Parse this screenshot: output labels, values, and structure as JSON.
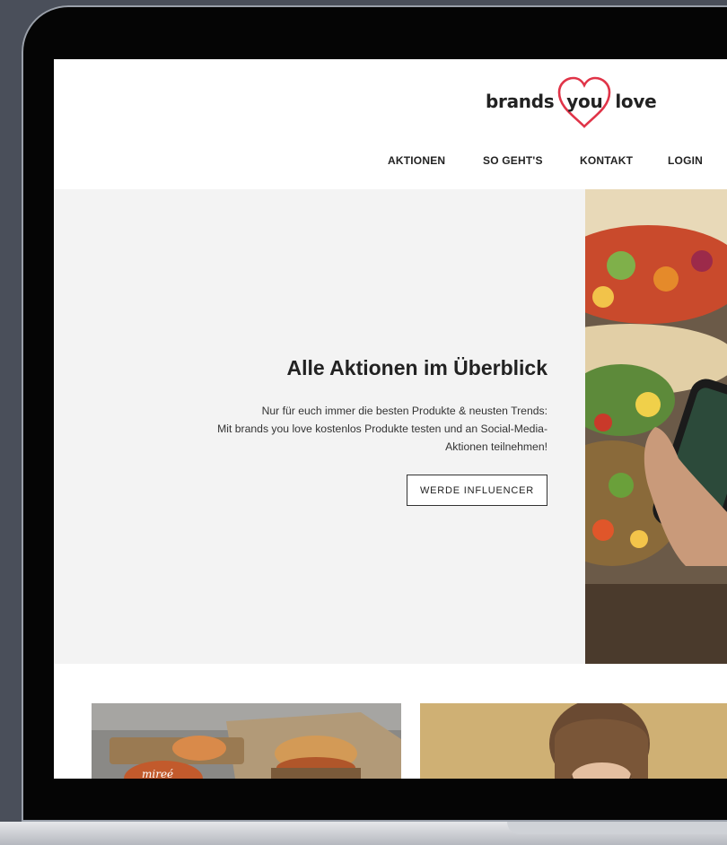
{
  "site": {
    "logo": {
      "part1": "brands",
      "part2": "you",
      "part3": "love",
      "heart_color": "#e03448"
    },
    "nav": [
      {
        "label": "AKTIONEN"
      },
      {
        "label": "SO GEHT'S"
      },
      {
        "label": "KONTAKT"
      },
      {
        "label": "LOGIN"
      }
    ]
  },
  "hero": {
    "title": "Alle Aktionen im Überblick",
    "line1": "Nur für euch immer die besten Produkte & neusten Trends:",
    "line2": "Mit brands you love kostenlos Produkte testen und an Social-Media-",
    "line3": "Aktionen teilnehmen!",
    "cta": "WERDE INFLUENCER",
    "image": "tacos-photo-with-phone"
  },
  "cards": [
    {
      "image": "burger-food-photo",
      "badge": "mireé"
    },
    {
      "image": "woman-in-field-photo"
    }
  ]
}
